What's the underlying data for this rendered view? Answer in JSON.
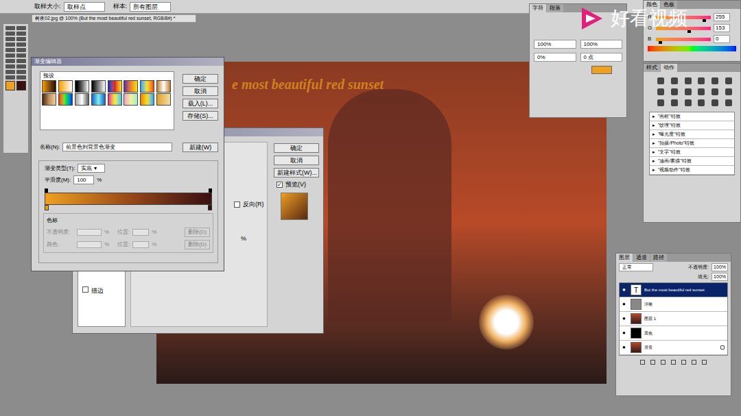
{
  "window": {
    "title": "树夜02.jpg @ 100% (But the most beautiful red sunset, RGB/8#) *"
  },
  "option_bar": {
    "fields": [
      {
        "label": "取样大小:",
        "value": "取样点"
      },
      {
        "label": "样本:",
        "value": "所有图层"
      }
    ]
  },
  "watermark": "好看视频",
  "canvas": {
    "text": "e most beautiful red sunset"
  },
  "gradient_editor": {
    "title": "渐变编辑器",
    "presets_label": "预设",
    "buttons": [
      "确定",
      "取消",
      "载入(L)...",
      "存储(S)..."
    ],
    "name_label": "名称(N):",
    "name_value": "前景色到背景色渐变",
    "new_button": "新建(W)",
    "type_label": "渐变类型(T):",
    "type_value": "实底",
    "smooth_label": "平滑度(M):",
    "smooth_value": "100",
    "unit": "%",
    "stops_label": "色标",
    "stop_rows": [
      {
        "label": "不透明度:",
        "position_label": "位置:",
        "unit": "%",
        "delete": "删除(D)",
        "disabled": true
      },
      {
        "label": "颜色:",
        "position_label": "位置:",
        "unit": "%",
        "delete": "删除(D)",
        "disabled": true
      }
    ]
  },
  "layer_style": {
    "buttons": [
      "确定",
      "取消",
      "新建样式(W)..."
    ],
    "preview": {
      "label": "预览(V)",
      "checked": true
    },
    "reverse": {
      "label": "反向(R)",
      "checked": false
    },
    "unit": "%",
    "side_item": {
      "label": "描边",
      "checked": false
    }
  },
  "character_panel": {
    "tabs": [
      {
        "label": "字符",
        "selected": true
      },
      {
        "label": "段落",
        "selected": false
      }
    ],
    "values": [
      "100%",
      "100%",
      "0%",
      "0 点"
    ]
  },
  "color_panel": {
    "tabs": [
      {
        "label": "颜色",
        "selected": true
      },
      {
        "label": "色板",
        "selected": false
      }
    ],
    "channels": [
      {
        "name": "R",
        "value": "255",
        "level": 0.9
      },
      {
        "name": "G",
        "value": "153",
        "level": 0.6
      },
      {
        "name": "B",
        "value": "0",
        "level": 0.05
      }
    ]
  },
  "actions_panel": {
    "tabs": [
      {
        "label": "样式",
        "selected": false
      },
      {
        "label": "动作",
        "selected": true
      }
    ],
    "items": [
      "\"画框\"特效",
      "\"纹理\"特效",
      "\"曝光度\"特效",
      "\"拍摄/Photo\"特效",
      "\"文字\"特效",
      "\"油画/素描\"特效",
      "\"视频动作\"特效"
    ]
  },
  "layers_panel": {
    "tabs": [
      {
        "label": "图层",
        "selected": true
      },
      {
        "label": "通道",
        "selected": false
      },
      {
        "label": "路径",
        "selected": false
      }
    ],
    "blend_mode": "正常",
    "opacity_label": "不透明度:",
    "opacity": "100%",
    "fill_label": "填充:",
    "fill": "100%",
    "layers": [
      {
        "name": "But the most beautiful red sunset",
        "kind": "text",
        "visible": true,
        "selected": true,
        "locked": false
      },
      {
        "name": "浮雕",
        "kind": "gray",
        "visible": true,
        "selected": false,
        "locked": false
      },
      {
        "name": "图层 1",
        "kind": "photo",
        "visible": true,
        "selected": false,
        "locked": false
      },
      {
        "name": "黑色",
        "kind": "black",
        "visible": true,
        "selected": false,
        "locked": false
      },
      {
        "name": "背景",
        "kind": "photo",
        "visible": true,
        "selected": false,
        "locked": true
      }
    ]
  }
}
